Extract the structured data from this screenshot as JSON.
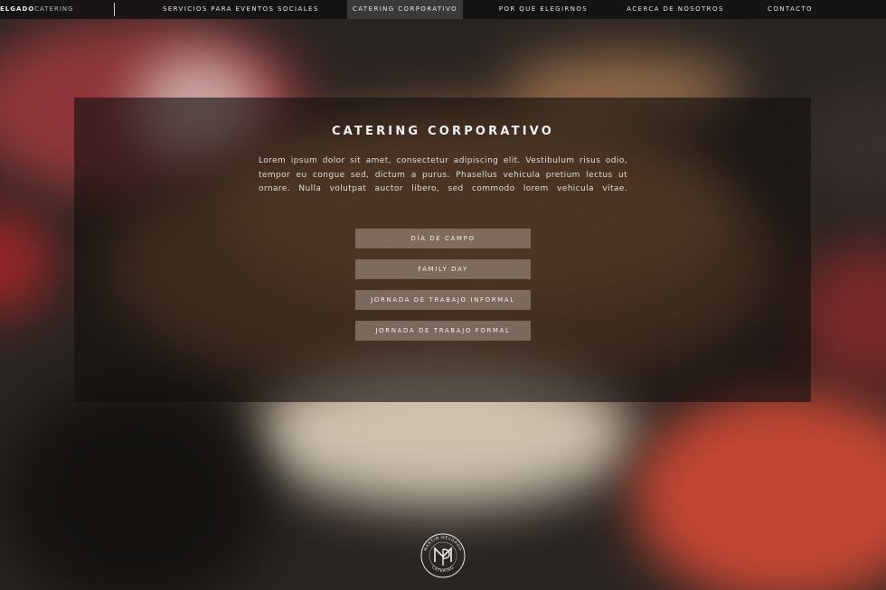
{
  "nav": {
    "brand_strong": "ELGADO",
    "brand_light": "CATERING",
    "items": [
      {
        "label": "SERVICIOS PARA EVENTOS SOCIALES"
      },
      {
        "label": "CATERING CORPORATIVO"
      },
      {
        "label": "POR QUÉ ELEGIRNOS"
      },
      {
        "label": "ACERCA DE NOSOTROS"
      },
      {
        "label": "CONTACTO"
      }
    ]
  },
  "hero": {
    "title": "CATERING CORPORATIVO",
    "body": "Lorem ipsum dolor sit amet, consectetur adipiscing elit. Vestibulum risus odio, tempor eu congue sed, dictum a purus. Phasellus vehicula pretium lectus ut ornare. Nulla volutpat auctor libero, sed commodo lorem vehicula vitae.",
    "options": [
      {
        "label": "DÍA DE CAMPO"
      },
      {
        "label": "FAMILY DAY"
      },
      {
        "label": "JORNADA DE TRABAJO INFORMAL"
      },
      {
        "label": "JORNADA DE TRABAJO FORMAL"
      }
    ]
  },
  "logo": {
    "arc_top": "MARTIN DELGADO",
    "arc_bottom": "CATERING"
  },
  "colors": {
    "nav_bg": "#121212",
    "nav_active": "#3a3a3a",
    "button_bg": "#a08c82",
    "text": "#f2f2f2"
  }
}
